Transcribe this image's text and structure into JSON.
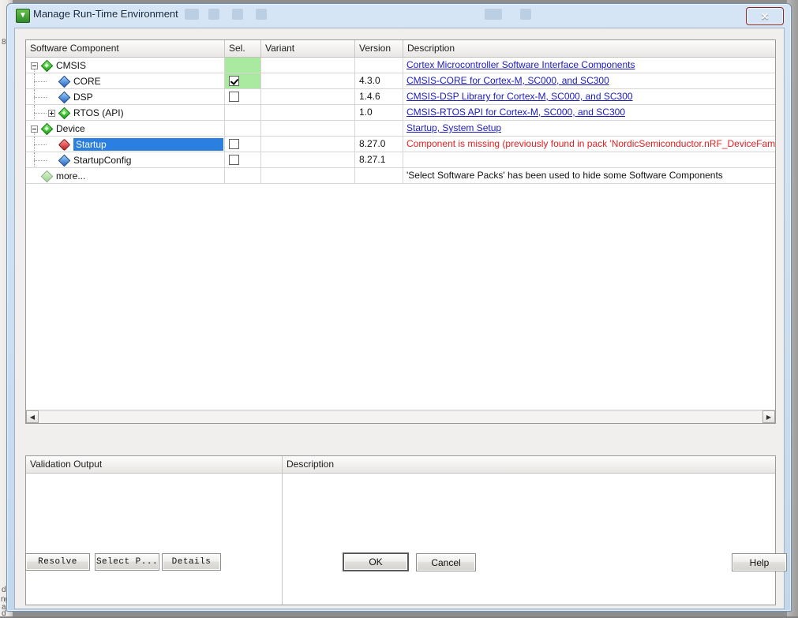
{
  "window": {
    "title": "Manage Run-Time Environment",
    "icon": "keil-uvision-icon",
    "close_label": "✕"
  },
  "tree_table": {
    "columns": [
      {
        "key": "name",
        "label": "Software Component"
      },
      {
        "key": "sel",
        "label": "Sel."
      },
      {
        "key": "variant",
        "label": "Variant"
      },
      {
        "key": "version",
        "label": "Version"
      },
      {
        "key": "desc",
        "label": "Description"
      }
    ],
    "rows": [
      {
        "label": "CMSIS",
        "indent": 0,
        "expander": "minus",
        "icon": "green-diamond-icon",
        "selected": false,
        "checkbox": "none",
        "sel_bg": "#aaeaa0",
        "variant": "",
        "version": "",
        "desc": "Cortex Microcontroller Software Interface Components",
        "desc_style": "link"
      },
      {
        "label": "CORE",
        "indent": 1,
        "expander": "none",
        "icon": "blue-diamond-icon",
        "selected": false,
        "checkbox": "checked",
        "sel_bg": "#aaeaa0",
        "variant": "",
        "version": "4.3.0",
        "desc": "CMSIS-CORE for Cortex-M, SC000, and SC300",
        "desc_style": "link"
      },
      {
        "label": "DSP",
        "indent": 1,
        "expander": "none",
        "icon": "blue-diamond-icon",
        "selected": false,
        "checkbox": "unchecked",
        "sel_bg": "",
        "variant": "",
        "version": "1.4.6",
        "desc": "CMSIS-DSP Library for Cortex-M, SC000, and SC300",
        "desc_style": "link"
      },
      {
        "label": "RTOS (API)",
        "indent": 1,
        "expander": "plus",
        "icon": "green-diamond-icon",
        "selected": false,
        "checkbox": "none",
        "sel_bg": "",
        "variant": "",
        "version": "1.0",
        "desc": "CMSIS-RTOS API for Cortex-M, SC000, and SC300",
        "desc_style": "link"
      },
      {
        "label": "Device",
        "indent": 0,
        "expander": "minus",
        "icon": "green-diamond-icon",
        "selected": false,
        "checkbox": "none",
        "sel_bg": "",
        "variant": "",
        "version": "",
        "desc": "Startup, System Setup",
        "desc_style": "link"
      },
      {
        "label": "Startup",
        "indent": 1,
        "expander": "none",
        "icon": "red-diamond-icon",
        "selected": true,
        "checkbox": "unchecked",
        "sel_bg": "",
        "variant": "",
        "version": "8.27.0",
        "desc": "Component is missing (previously found in pack 'NordicSemiconductor.nRF_DeviceFamilyP.",
        "desc_style": "error"
      },
      {
        "label": "StartupConfig",
        "indent": 1,
        "expander": "none",
        "icon": "blue-diamond-icon",
        "selected": false,
        "checkbox": "unchecked",
        "sel_bg": "",
        "variant": "",
        "version": "8.27.1",
        "desc": "",
        "desc_style": "plain"
      },
      {
        "label": "more...",
        "indent": 0,
        "expander": "none",
        "icon": "pale-diamond-icon",
        "selected": false,
        "checkbox": "none",
        "sel_bg": "",
        "variant": "",
        "version": "",
        "desc": "'Select Software Packs' has been used to hide some Software Components",
        "desc_style": "plain"
      }
    ],
    "hscrollbar": {
      "left_arrow": "◀",
      "right_arrow": "▶"
    }
  },
  "validation_panel": {
    "columns": [
      {
        "key": "validation_output",
        "label": "Validation Output"
      },
      {
        "key": "description",
        "label": "Description"
      }
    ],
    "rows": []
  },
  "buttons": {
    "resolve": "Resolve",
    "select_packs": "Select P...",
    "details": "Details",
    "ok": "OK",
    "cancel": "Cancel",
    "help": "Help"
  },
  "backdrop": {
    "left_text_1": "8",
    "left_text_2": "d",
    "left_text_3": "ng",
    "left_text_4": "a",
    "left_text_5": "d"
  },
  "colors": {
    "title_gradient_top": "#d6e5f5",
    "title_gradient_bottom": "#c3d7ec",
    "selection_blue": "#2a7fe0",
    "sel_green": "#aaeaa0",
    "link_blue": "#1b1bbd",
    "error_red": "#e02020",
    "close_red": "#c4281a"
  }
}
